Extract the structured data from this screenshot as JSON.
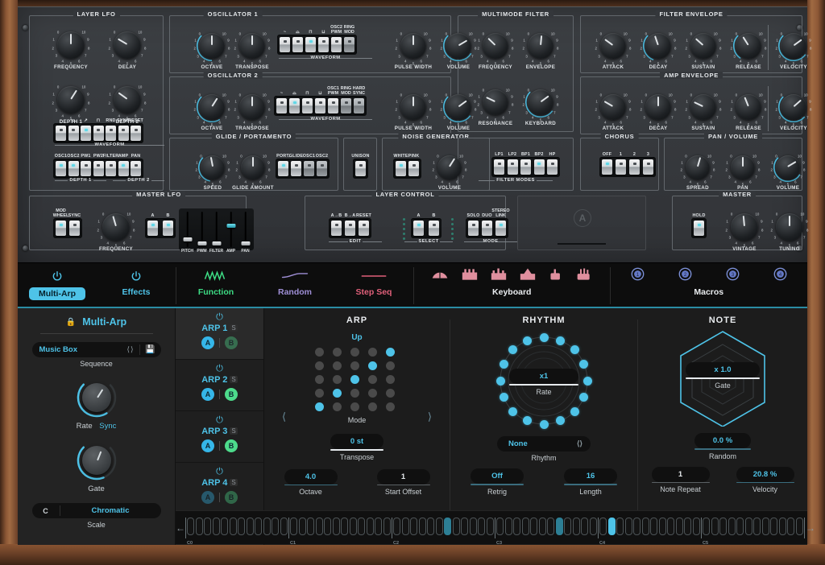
{
  "hardware": {
    "layer_lfo": {
      "title": "LAYER LFO",
      "knobs": [
        {
          "label": "FREQUENCY",
          "value": 0.5,
          "arc": false
        },
        {
          "label": "DELAY",
          "value": 0.28,
          "arc": false
        },
        {
          "label": "DEPTH 1",
          "value": 0.62,
          "arc": false
        },
        {
          "label": "DEPTH 2",
          "value": 0.3,
          "arc": false
        }
      ],
      "waveform_label": "WAVEFORM",
      "waveform_switches": [
        {
          "label": "~",
          "on": false
        },
        {
          "label": "⌓",
          "on": false
        },
        {
          "label": "↗",
          "on": true
        },
        {
          "label": "⊓",
          "on": false
        },
        {
          "label": "RND",
          "on": false
        },
        {
          "label": "SYNC",
          "on": false
        },
        {
          "label": "RESET",
          "on": false
        }
      ],
      "depth_switches": [
        {
          "label": "OSC1",
          "on": true
        },
        {
          "label": "OSC2",
          "on": true
        },
        {
          "label": "PW1",
          "on": false
        },
        {
          "label": "PW2",
          "on": false
        },
        {
          "label": "FILTER",
          "on": false
        },
        {
          "label": "AMP",
          "on": true
        },
        {
          "label": "PAN",
          "on": false
        }
      ],
      "depth1_label": "DEPTH 1",
      "depth2_label": "DEPTH 2"
    },
    "osc1": {
      "title": "OSCILLATOR 1",
      "knobs": [
        {
          "label": "OCTAVE",
          "value": 0.5,
          "arc": true
        },
        {
          "label": "TRANSPOSE",
          "value": 0.5,
          "arc": false
        },
        {
          "label": "PULSE WIDTH",
          "value": 0.5,
          "arc": false
        },
        {
          "label": "VOLUME",
          "value": 0.72,
          "arc": true
        }
      ],
      "waveform_label": "WAVEFORM",
      "switches": [
        {
          "label": "~",
          "on": false
        },
        {
          "label": "⌓",
          "on": false
        },
        {
          "label": "⊓",
          "on": true
        },
        {
          "label": "⊔",
          "on": false
        },
        {
          "label": "OSC2 PWM",
          "on": false
        },
        {
          "label": "RING MOD",
          "on": false
        }
      ]
    },
    "osc2": {
      "title": "OSCILLATOR 2",
      "knobs": [
        {
          "label": "OCTAVE",
          "value": 0.62,
          "arc": true
        },
        {
          "label": "TRANSPOSE",
          "value": 0.5,
          "arc": false
        },
        {
          "label": "PULSE WIDTH",
          "value": 0.5,
          "arc": false
        },
        {
          "label": "VOLUME",
          "value": 0.7,
          "arc": true
        }
      ],
      "waveform_label": "WAVEFORM",
      "switches": [
        {
          "label": "~",
          "on": false
        },
        {
          "label": "⌓",
          "on": true
        },
        {
          "label": "⊓",
          "on": false
        },
        {
          "label": "⊔",
          "on": false
        },
        {
          "label": "OSC1 PWM",
          "on": false
        },
        {
          "label": "RING MOD",
          "on": false
        },
        {
          "label": "HARD SYNC",
          "on": false
        }
      ]
    },
    "glide": {
      "title": "GLIDE / PORTAMENTO",
      "knobs": [
        {
          "label": "SPEED",
          "value": 0.46,
          "arc": true
        },
        {
          "label": "GLIDE AMOUNT",
          "value": 0.5,
          "arc": false
        }
      ],
      "switches": [
        {
          "label": "PORT.",
          "on": true
        },
        {
          "label": "GLIDE",
          "on": false
        },
        {
          "label": "OSC1",
          "on": false
        },
        {
          "label": "OSC2",
          "on": false
        }
      ]
    },
    "unison": {
      "label": "UNISON",
      "on": false
    },
    "noise": {
      "title": "NOISE GENERATOR",
      "switches": [
        {
          "label": "WHITE",
          "on": true
        },
        {
          "label": "PINK",
          "on": false
        }
      ],
      "knobs": [
        {
          "label": "VOLUME",
          "value": 0.62,
          "arc": false
        }
      ]
    },
    "filter_modes": {
      "label": "FILTER MODES",
      "switches": [
        {
          "label": "LP1",
          "on": false
        },
        {
          "label": "LP2",
          "on": false
        },
        {
          "label": "BP1",
          "on": false
        },
        {
          "label": "BP2",
          "on": true
        },
        {
          "label": "HP",
          "on": false
        }
      ]
    },
    "multimode_filter": {
      "title": "MULTIMODE FILTER",
      "knobs": [
        {
          "label": "FREQUENCY",
          "value": 0.33,
          "arc": false
        },
        {
          "label": "ENVELOPE",
          "value": 0.52,
          "arc": false
        },
        {
          "label": "RESONANCE",
          "value": 0.26,
          "arc": false
        },
        {
          "label": "KEYBOARD",
          "value": 0.7,
          "arc": true
        }
      ]
    },
    "filter_envelope": {
      "title": "FILTER ENVELOPE",
      "knobs": [
        {
          "label": "ATTACK",
          "value": 0.3,
          "arc": false
        },
        {
          "label": "DECAY",
          "value": 0.43,
          "arc": true
        },
        {
          "label": "SUSTAIN",
          "value": 0.32,
          "arc": false
        },
        {
          "label": "RELEASE",
          "value": 0.38,
          "arc": true
        },
        {
          "label": "VELOCITY",
          "value": 0.7,
          "arc": true
        }
      ]
    },
    "amp_envelope": {
      "title": "AMP ENVELOPE",
      "knobs": [
        {
          "label": "ATTACK",
          "value": 0.28,
          "arc": false
        },
        {
          "label": "DECAY",
          "value": 0.5,
          "arc": false
        },
        {
          "label": "SUSTAIN",
          "value": 0.26,
          "arc": false
        },
        {
          "label": "RELEASE",
          "value": 0.42,
          "arc": false
        },
        {
          "label": "VELOCITY",
          "value": 0.68,
          "arc": true
        }
      ]
    },
    "chorus": {
      "title": "CHORUS",
      "switches": [
        {
          "label": "OFF",
          "on": true
        },
        {
          "label": "1",
          "on": false
        },
        {
          "label": "2",
          "on": false
        },
        {
          "label": "3",
          "on": false
        }
      ]
    },
    "pan_volume": {
      "title": "PAN / VOLUME",
      "knobs": [
        {
          "label": "SPREAD",
          "value": 0.56,
          "arc": false
        },
        {
          "label": "PAN",
          "value": 0.5,
          "arc": false
        },
        {
          "label": "VOLUME",
          "value": 0.72,
          "arc": true
        }
      ]
    },
    "master_lfo": {
      "title": "MASTER LFO",
      "switches": [
        {
          "label": "MOD WHEEL",
          "on": true
        },
        {
          "label": "SYNC",
          "on": false
        }
      ],
      "knobs": [
        {
          "label": "FREQUENCY",
          "value": 0.44,
          "arc": false
        }
      ],
      "ab_switches": [
        {
          "label": "A",
          "on": true
        },
        {
          "label": "B",
          "on": true
        }
      ],
      "faders": [
        {
          "label": "PITCH",
          "value": 0.18
        },
        {
          "label": "PWM",
          "value": 0.06
        },
        {
          "label": "FILTER",
          "value": 0.05
        },
        {
          "label": "AMP",
          "value": 0.62,
          "cyan": true
        },
        {
          "label": "PAN",
          "value": 0.05
        }
      ]
    },
    "layer_control": {
      "title": "LAYER CONTROL",
      "edit_label": "EDIT",
      "select_label": "SELECT",
      "mode_label": "MODE",
      "edit_switches": [
        {
          "label": "A→B",
          "on": false
        },
        {
          "label": "B→A",
          "on": false
        },
        {
          "label": "RESET",
          "on": false
        }
      ],
      "select_switches": [
        {
          "label": "A",
          "on": true
        },
        {
          "label": "B",
          "on": false
        }
      ],
      "mode_switches": [
        {
          "label": "SOLO",
          "on": false
        },
        {
          "label": "DUO",
          "on": false
        },
        {
          "label": "STEREO LINK",
          "on": true
        }
      ]
    },
    "master": {
      "title": "MASTER",
      "hold": {
        "label": "HOLD",
        "on": true
      },
      "knobs": [
        {
          "label": "VINTAGE",
          "value": 0.48,
          "arc": false
        },
        {
          "label": "TUNING",
          "value": 0.5,
          "arc": false
        }
      ]
    },
    "logo": "A"
  },
  "tabs": [
    {
      "label": "Multi-Arp",
      "icon": "power-icon",
      "color": "#4ec3e8",
      "active": true
    },
    {
      "label": "Effects",
      "icon": "power-icon",
      "color": "#4ec3e8",
      "active": false
    },
    {
      "label": "Function",
      "icon": "lfo-wave-icon",
      "color": "#3ddc84",
      "active": false
    },
    {
      "label": "Random",
      "icon": "random-curve-icon",
      "color": "#9f8fd6",
      "active": false
    },
    {
      "label": "Step Seq",
      "icon": "step-line-icon",
      "color": "#e0607a",
      "active": false
    }
  ],
  "keyboard_group": {
    "label": "Keyboard",
    "icons": [
      "pitch-bend-icon",
      "keyboard-scale-icon",
      "keyboard-split-icon",
      "keyboard-zone-icon",
      "aftertouch-icon",
      "key-velocity-icon"
    ],
    "color": "#e59aa8"
  },
  "macros_group": {
    "label": "Macros",
    "icons": [
      "macro-1-icon",
      "macro-2-icon",
      "macro-3-icon",
      "macro-4-icon"
    ],
    "labels": [
      "1",
      "2",
      "3",
      "4"
    ],
    "color": "#7b8fd6"
  },
  "multi_arp": {
    "title": "Multi-Arp",
    "lock_icon": "lock-icon",
    "sequence": {
      "value": "Music Box",
      "label": "Sequence",
      "prev_icon": "chevron-left-icon",
      "next_icon": "chevron-right-icon",
      "save_icon": "save-icon"
    },
    "rate": {
      "label": "Rate",
      "sync_label": "Sync",
      "value": 0.62
    },
    "gate": {
      "label": "Gate",
      "value": 0.58
    },
    "scale": {
      "key": "C",
      "name": "Chromatic",
      "label": "Scale"
    }
  },
  "arps": [
    {
      "name": "ARP 1",
      "solo": "S",
      "power_icon": "power-icon",
      "a_active": true,
      "b_active": false,
      "selected": true
    },
    {
      "name": "ARP 2",
      "solo": "S",
      "power_icon": "power-icon",
      "a_active": true,
      "b_active": true,
      "selected": false
    },
    {
      "name": "ARP 3",
      "solo": "S",
      "power_icon": "power-icon",
      "a_active": true,
      "b_active": true,
      "selected": false
    },
    {
      "name": "ARP 4",
      "solo": "S",
      "power_icon": "power-icon",
      "a_active": false,
      "b_active": false,
      "selected": false
    }
  ],
  "arp_section": {
    "title": "ARP",
    "mode_value": "Up",
    "mode_label": "Mode",
    "prev_icon": "chevron-left-icon",
    "next_icon": "chevron-right-icon",
    "grid_on": [
      4,
      8,
      12,
      16,
      20
    ],
    "grid_rows": 5,
    "grid_cols": 5,
    "transpose": {
      "value": "0 st",
      "label": "Transpose"
    },
    "octave": {
      "value": "4.0",
      "label": "Octave"
    },
    "start_offset": {
      "value": "1",
      "label": "Start Offset"
    }
  },
  "rhythm_section": {
    "title": "RHYTHM",
    "rate": {
      "value": "x1",
      "label": "Rate"
    },
    "dot_count": 16,
    "rhythm": {
      "value": "None",
      "label": "Rhythm",
      "prev_icon": "chevron-left-icon",
      "next_icon": "chevron-right-icon"
    },
    "retrig": {
      "value": "Off",
      "label": "Retrig"
    },
    "length": {
      "value": "16",
      "label": "Length"
    }
  },
  "note_section": {
    "title": "NOTE",
    "gate": {
      "value": "x 1.0",
      "label": "Gate"
    },
    "random": {
      "value": "0.0 %",
      "label": "Random"
    },
    "note_repeat": {
      "value": "1",
      "label": "Note Repeat"
    },
    "velocity": {
      "value": "20.8 %",
      "label": "Velocity"
    }
  },
  "keyboard_strip": {
    "left_icon": "arrow-left-icon",
    "right_icon": "arrow-right-icon",
    "octave_labels": [
      "C0",
      "C1",
      "C2",
      "C3",
      "C4",
      "C5"
    ],
    "keys_per_octave": 12,
    "lit_keys": [
      30,
      43,
      49
    ],
    "lit_bright": [
      49
    ]
  },
  "colors": {
    "accent": "#4ec3e8",
    "green": "#3ddc84",
    "purple": "#9f8fd6",
    "pink": "#e0607a",
    "panel_bg": "#1c1c1c",
    "wood": "#8b5632"
  }
}
